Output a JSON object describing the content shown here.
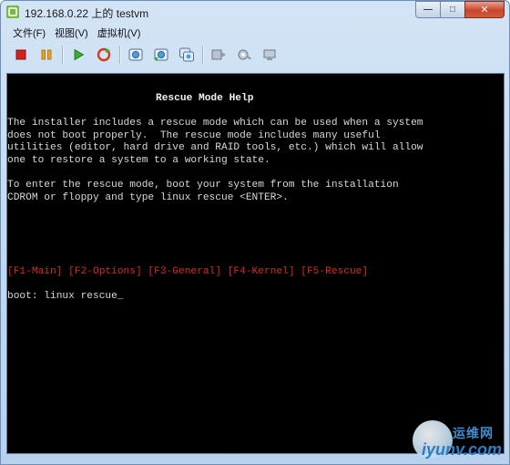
{
  "window": {
    "title": "192.168.0.22 上的 testvm",
    "buttons": {
      "minimize": "—",
      "maximize": "□",
      "close": "✕"
    }
  },
  "menu": {
    "items": [
      "文件(F)",
      "视图(V)",
      "虚拟机(V)"
    ]
  },
  "toolbar": {
    "icons": [
      "stop-icon",
      "pause-icon",
      "play-icon",
      "reset-icon",
      "snapshot-icon",
      "revert-snapshot-icon",
      "manage-snapshots-icon",
      "connect-device-icon",
      "settings-icon",
      "network-icon"
    ]
  },
  "console": {
    "title": "Rescue Mode Help",
    "para1": [
      "The installer includes a rescue mode which can be used when a system",
      "does not boot properly.  The rescue mode includes many useful",
      "utilities (editor, hard drive and RAID tools, etc.) which will allow",
      "one to restore a system to a working state."
    ],
    "para2": [
      "To enter the rescue mode, boot your system from the installation",
      "CDROM or floppy and type linux rescue <ENTER>."
    ],
    "fkeys": "[F1-Main] [F2-Options] [F3-General] [F4-Kernel] [F5-Rescue]",
    "prompt": "boot: linux rescue_"
  },
  "watermark": {
    "top": "运维网",
    "bottom": "iyunv.com"
  },
  "colors": {
    "console_bg": "#000000",
    "console_text": "#d9d9d9",
    "fkeys_red": "#d72a1e"
  }
}
